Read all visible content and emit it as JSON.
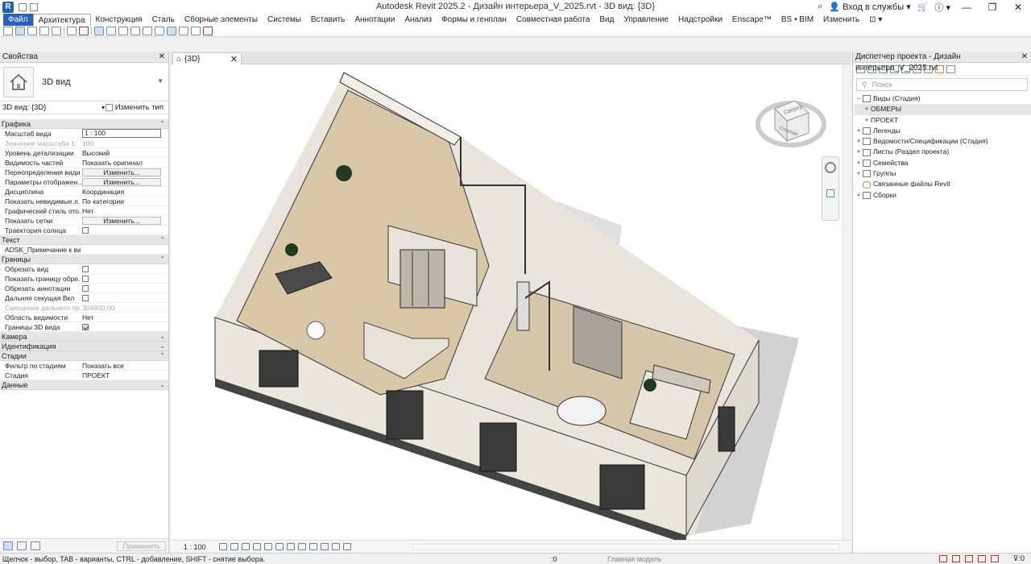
{
  "window": {
    "title": "Autodesk Revit 2025.2 - Дизайн интерьера_V_2025.rvt - 3D вид: {3D}",
    "signin": "Вход в службы",
    "help": "?",
    "app_letter": "R"
  },
  "menu": {
    "items": [
      "Файл",
      "Архитектура",
      "Конструкция",
      "Сталь",
      "Сборные элементы",
      "Системы",
      "Вставить",
      "Аннотации",
      "Анализ",
      "Формы и генплан",
      "Совместная работа",
      "Вид",
      "Управление",
      "Надстройки",
      "Enscape™",
      "BS • BIM",
      "Изменить"
    ]
  },
  "properties": {
    "panel_title": "Свойства",
    "type_name": "3D вид",
    "view_selector": "3D вид: {3D}",
    "edit_type": "Изменить тип",
    "sections": {
      "graphics": "Графика",
      "text": "Текст",
      "extents": "Границы",
      "camera": "Камера",
      "identity": "Идентификация",
      "phasing": "Стадии",
      "data": "Данные"
    },
    "rows": {
      "scale_k": "Масштаб вида",
      "scale_v": "1 : 100",
      "scale_val_k": "Значение масштаба",
      "scale_val_v": "100",
      "scale_val_prefix": "1:",
      "detail_k": "Уровень детализации",
      "detail_v": "Высокий",
      "parts_k": "Видимость частей",
      "parts_v": "Показать оригинал",
      "overrides_k": "Переопределения види...",
      "overrides_v": "Изменить...",
      "display_k": "Параметры отображен...",
      "display_v": "Изменить...",
      "discipline_k": "Дисциплина",
      "discipline_v": "Координация",
      "hidden_k": "Показать невидимые л...",
      "hidden_v": "По категории",
      "graphstyle_k": "Графический стиль ото...",
      "graphstyle_v": "Нет",
      "grids_k": "Показать сетки",
      "grids_v": "Изменить...",
      "sunpath_k": "Траектория солнца",
      "note_k": "ADSK_Примечание к ви...",
      "crop_k": "Обрезать вид",
      "cropshow_k": "Показать границу обре...",
      "annocrop_k": "Обрезать аннотации",
      "farclip_k": "Дальняя секущая Вкл",
      "faroffset_k": "Смещение дальнего пр...",
      "faroffset_v": "304800,00",
      "scopebox_k": "Область видимости",
      "scopebox_v": "Нет",
      "section3d_k": "Границы 3D вида",
      "phasefilter_k": "Фильтр по стадиям",
      "phasefilter_v": "Показать все",
      "phase_k": "Стадия",
      "phase_v": "ПРОЕКТ"
    },
    "apply": "Применить"
  },
  "viewport": {
    "tab_label": "{3D}",
    "scale": "1 : 100",
    "viewcube_top": "Сверху",
    "viewcube_front": "Спереди"
  },
  "browser": {
    "title": "Диспетчер проекта - Дизайн интерьера_V_2025.rvt",
    "search_placeholder": "Поиск",
    "nodes": {
      "views": "Виды (Стадия)",
      "survey": "ОБМЕРЫ",
      "project": "ПРОЕКТ",
      "legends": "Легенды",
      "schedules": "Ведомости/Спецификации (Стадия)",
      "sheets": "Листы (Раздел проекта)",
      "families": "Семейства",
      "groups": "Группы",
      "links": "Связанные файлы Revit",
      "assemblies": "Сборки"
    }
  },
  "status": {
    "message": "Щелчок - выбор, TAB - варианты, CTRL - добавление, SHIFT - снятие выбора.",
    "model": "Главная модель",
    "count": ":0"
  }
}
